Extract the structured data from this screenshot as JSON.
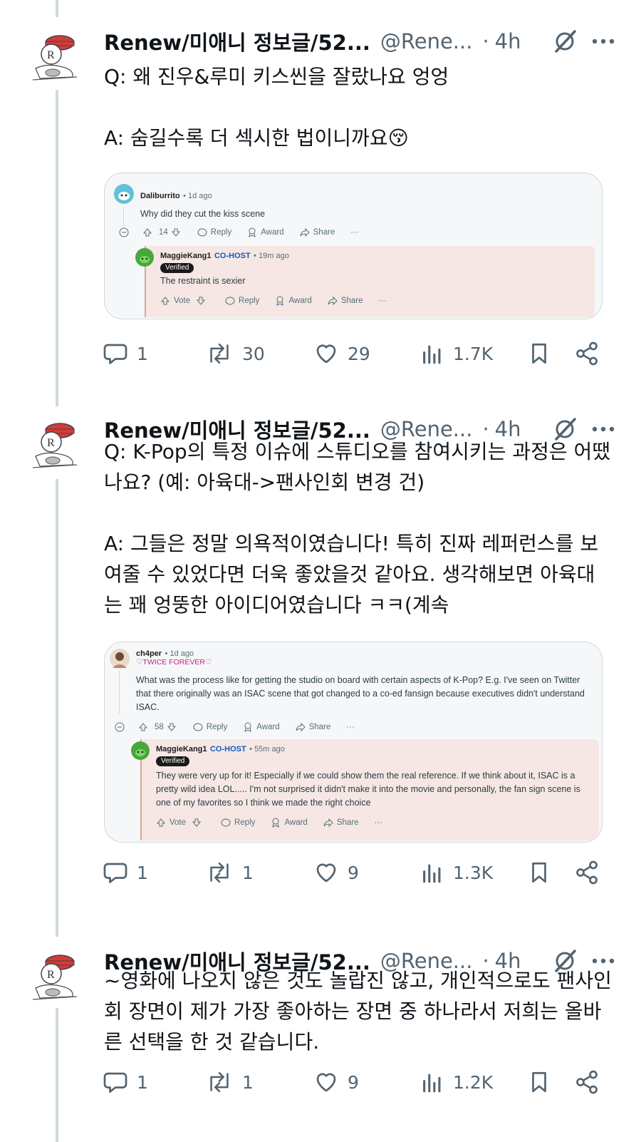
{
  "tweets": [
    {
      "author": "Renew/미애니 정보글/52...",
      "handle": "@Rene...",
      "dot": "·",
      "time": "4h",
      "lines": [
        "Q: 왜 진우&루미 키스씬을 잘랐나요 엉엉",
        "A: 숨길수록 더 섹시한 법이니까요😚"
      ],
      "embed": {
        "comment": {
          "user": "Daliburrito",
          "time": "• 1d ago",
          "text": "Why did they cut the kiss scene",
          "votes": "14",
          "reply": "Reply",
          "award": "Award",
          "share": "Share",
          "more": "···"
        },
        "reply": {
          "user": "MaggieKang1",
          "role": "CO-HOST",
          "time": "• 19m ago",
          "badge": "Verified",
          "text": "The restraint is sexier",
          "vote": "Vote",
          "reply": "Reply",
          "award": "Award",
          "share": "Share",
          "more": "···"
        }
      },
      "stats": {
        "replies": "1",
        "reposts": "30",
        "likes": "29",
        "views": "1.7K"
      }
    },
    {
      "author": "Renew/미애니 정보글/52...",
      "handle": "@Rene...",
      "dot": "·",
      "time": "4h",
      "lines": [
        "Q: K-Pop의 특정 이슈에 스튜디오를 참여시키는 과정은 어땠나요? (예: 아육대->팬사인회 변경 건)",
        "A: 그들은 정말 의욕적이였습니다! 특히 진짜 레퍼런스를 보여줄 수 있었다면 더욱 좋았을것 같아요. 생각해보면 아육대는 꽤 엉뚱한 아이디어였습니다 ㅋㅋ(계속"
      ],
      "embed": {
        "comment": {
          "user": "ch4per",
          "time": "• 1d ago",
          "flair": "♡TWICE FOREVER♡",
          "text": "What was the process like for getting the studio on board with certain aspects of K-Pop? E.g. I've seen on Twitter that there originally was an ISAC scene that got changed to a co-ed fansign because executives didn't understand ISAC.",
          "votes": "58",
          "reply": "Reply",
          "award": "Award",
          "share": "Share",
          "more": "···"
        },
        "reply": {
          "user": "MaggieKang1",
          "role": "CO-HOST",
          "time": "• 55m ago",
          "badge": "Verified",
          "text": "They were very up for it! Especially if we could show them the real reference. If we think about it, ISAC is a pretty wild idea LOL..... I'm not surprised it didn't make it into the movie and personally, the fan sign scene is one of my favorites so I think we made the right choice",
          "vote": "Vote",
          "reply": "Reply",
          "award": "Award",
          "share": "Share",
          "more": "···"
        }
      },
      "stats": {
        "replies": "1",
        "reposts": "1",
        "likes": "9",
        "views": "1.3K"
      }
    },
    {
      "author": "Renew/미애니 정보글/52...",
      "handle": "@Rene...",
      "dot": "·",
      "time": "4h",
      "lines": [
        "~영화에 나오지 않은 것도 놀랍진 않고, 개인적으로도 팬사인회 장면이 제가 가장 좋아하는 장면 중 하나라서 저희는 올바른 선택을 한 것 같습니다."
      ],
      "stats": {
        "replies": "1",
        "reposts": "1",
        "likes": "9",
        "views": "1.2K"
      }
    }
  ],
  "icons": {
    "reply": "speech-bubble-icon",
    "repost": "repost-icon",
    "like": "heart-icon",
    "views": "bar-chart-icon",
    "bookmark": "bookmark-icon",
    "share": "share-icon",
    "grok": "grok-slash-icon",
    "more": "more-dots-icon"
  },
  "colors": {
    "text": "#0f1419",
    "secondary": "#536471",
    "thread": "#cfd9de",
    "reddit_host": "#0a5dc2",
    "reddit_reply_bg": "#f6e7e4"
  }
}
